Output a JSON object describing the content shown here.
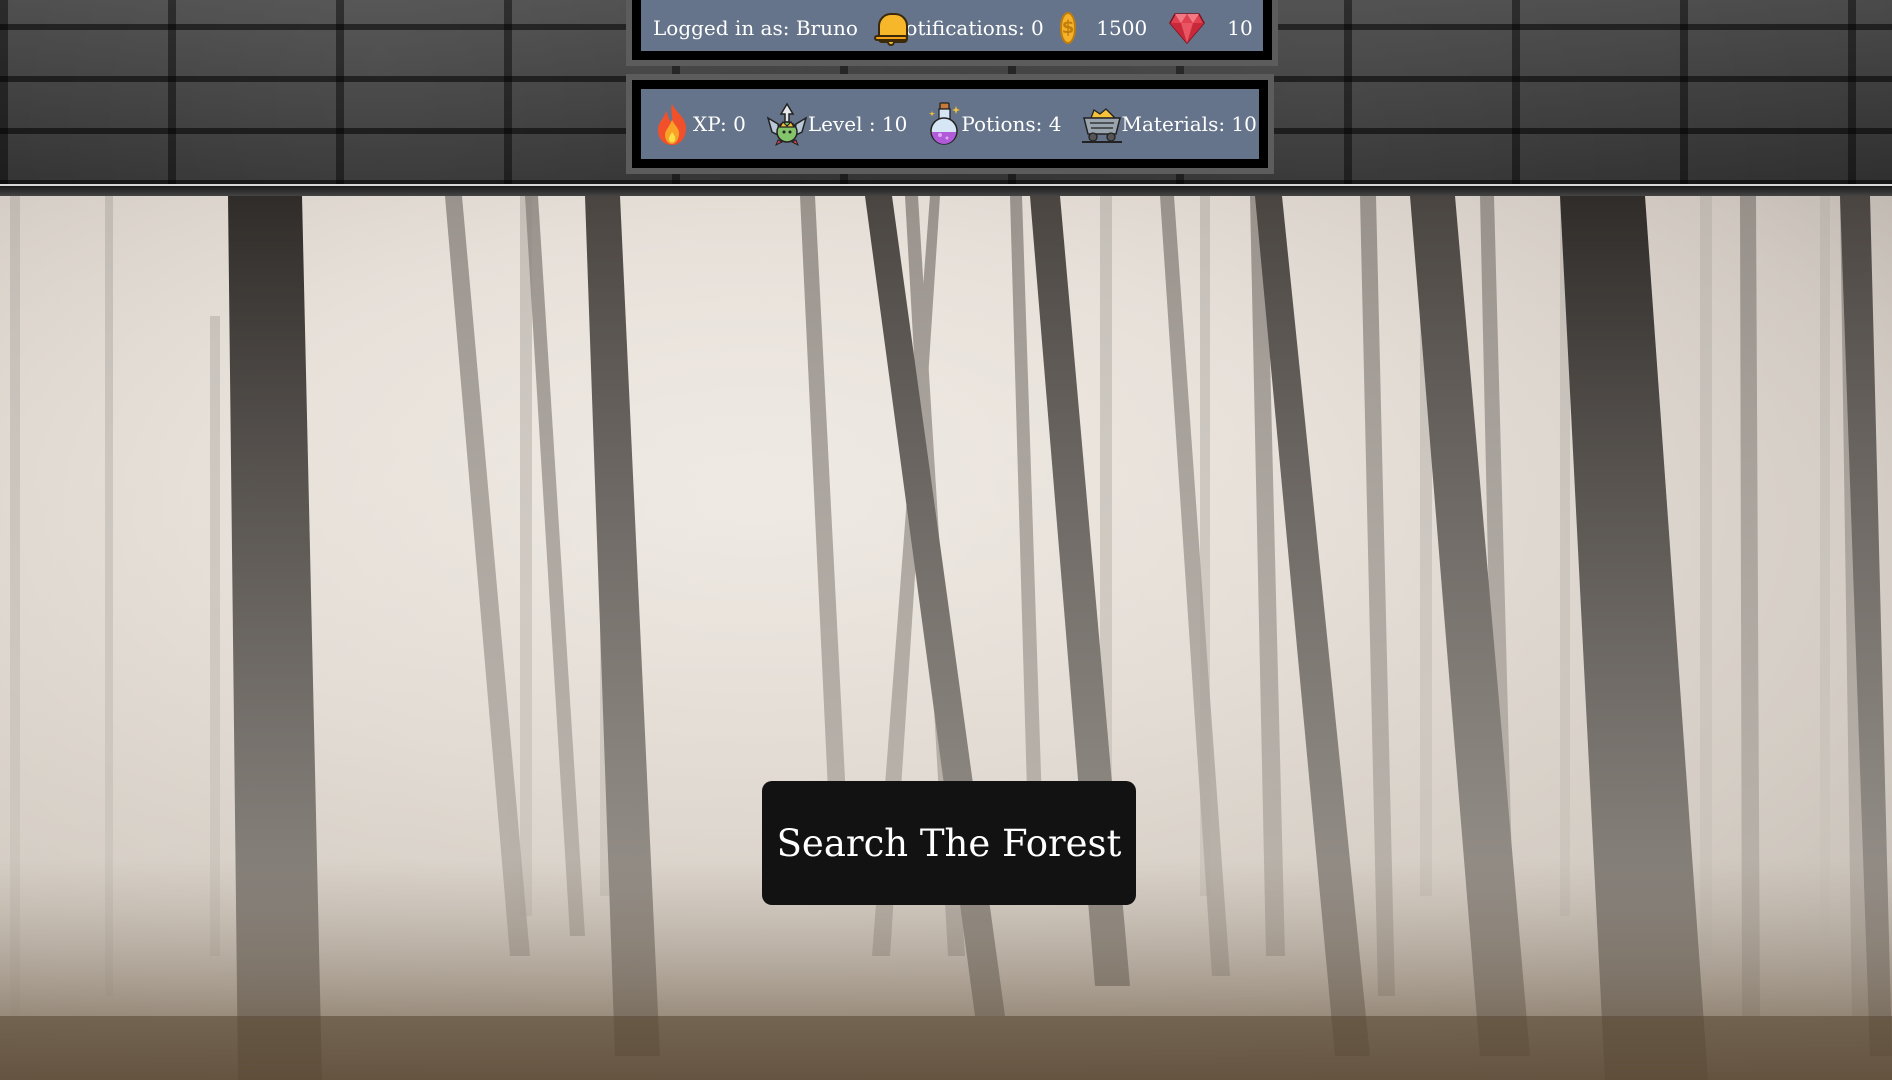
{
  "header": {
    "logged_in_label": "Logged in as: Bruno",
    "notifications_label": "Notifications: 0",
    "coins": "1500",
    "gems": "10",
    "xp_label": "XP: 0",
    "level_label": "Level : 10",
    "potions_label": "Potions: 4",
    "materials_label": "Materials: 10"
  },
  "icons": {
    "notifications": "bell-icon",
    "coins": "coin-icon",
    "gems": "gem-icon",
    "xp": "fire-icon",
    "level": "crown-level-icon",
    "potions": "potion-icon",
    "materials": "mine-cart-icon"
  },
  "main": {
    "action_button_label": "Search The Forest"
  },
  "colors": {
    "panel": "#65748a",
    "panel_border": "#000000",
    "button": "#121212",
    "coin": "#f4b22b",
    "gem": "#e0404f"
  }
}
